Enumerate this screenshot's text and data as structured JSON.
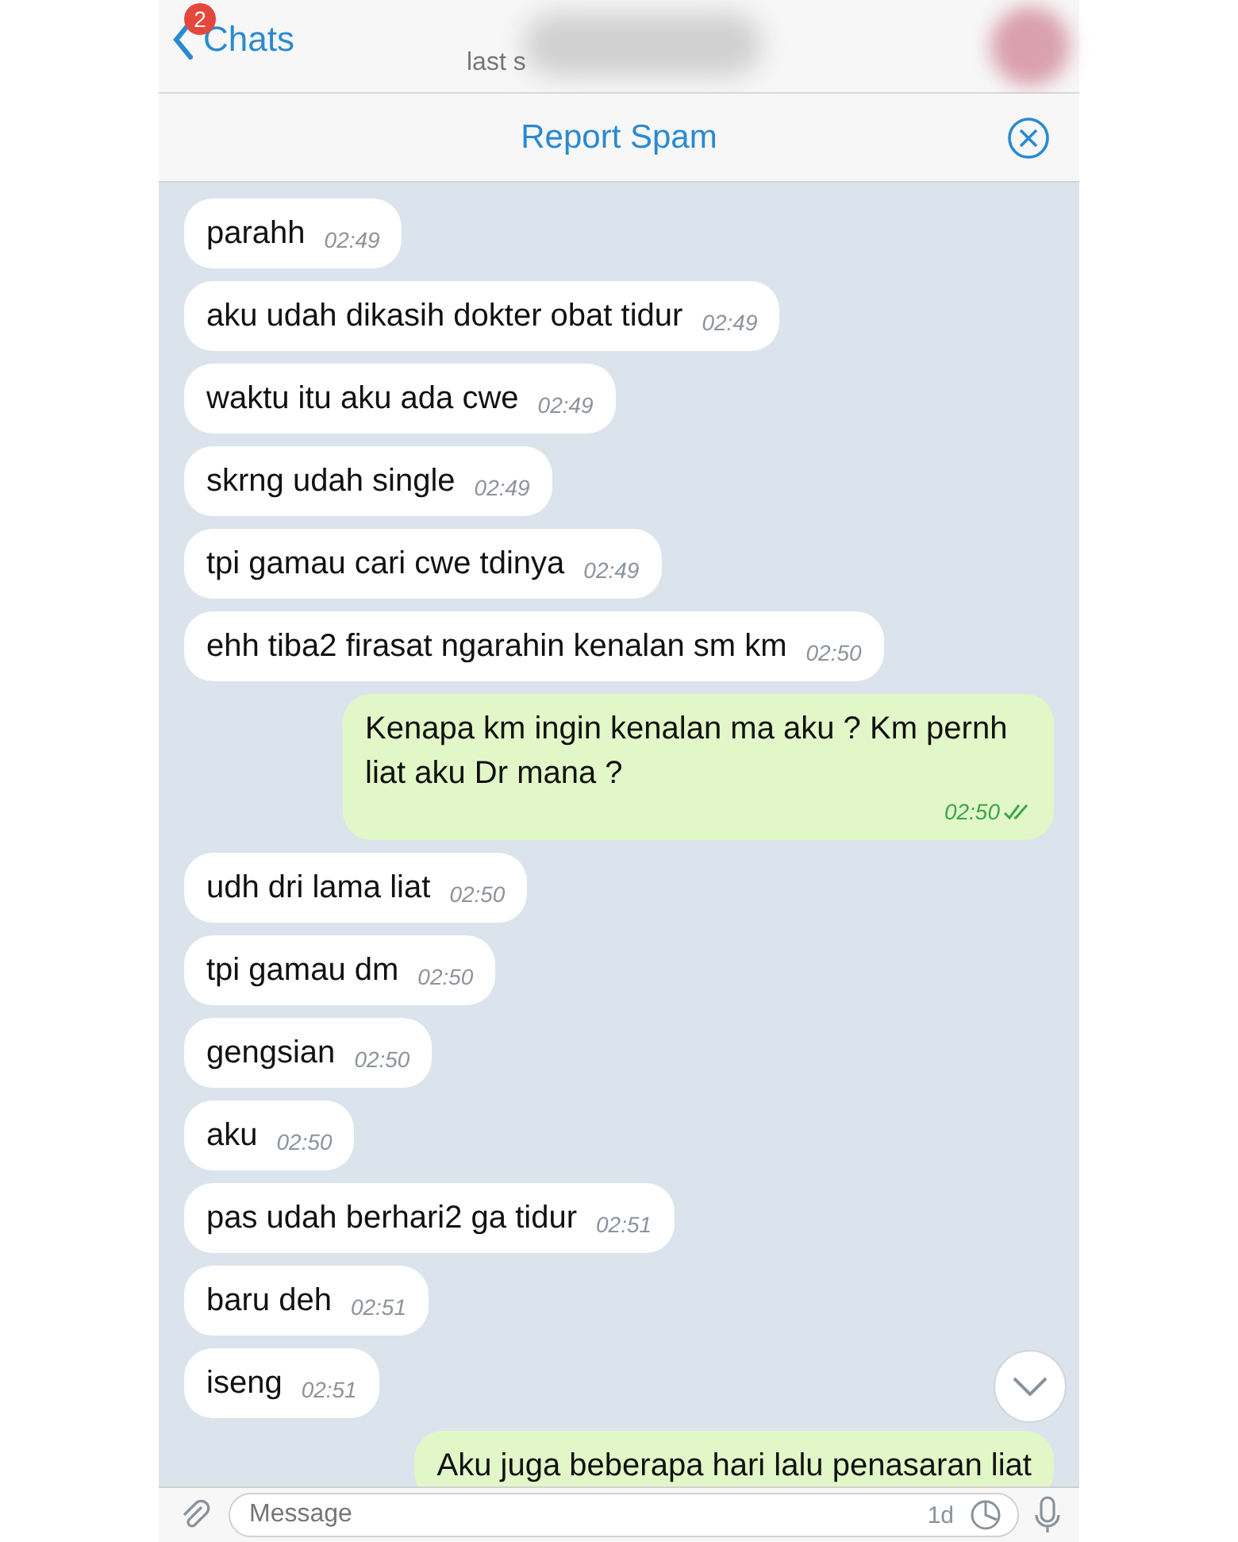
{
  "header": {
    "back_label": "Chats",
    "unread_badge": "2",
    "subtitle": "last s"
  },
  "report_bar": {
    "label": "Report Spam"
  },
  "messages": [
    {
      "kind": "incoming",
      "text": "parahh",
      "time": "02:49"
    },
    {
      "kind": "incoming",
      "text": "aku udah dikasih dokter obat tidur",
      "time": "02:49"
    },
    {
      "kind": "incoming",
      "text": "waktu itu aku ada cwe",
      "time": "02:49"
    },
    {
      "kind": "incoming",
      "text": "skrng udah single",
      "time": "02:49"
    },
    {
      "kind": "incoming",
      "text": "tpi gamau cari cwe tdinya",
      "time": "02:49"
    },
    {
      "kind": "incoming",
      "text": "ehh tiba2 firasat ngarahin kenalan sm km",
      "time": "02:50"
    },
    {
      "kind": "outgoing",
      "text": "Kenapa km ingin kenalan ma aku ? Km pernh liat aku Dr mana ?",
      "time": "02:50",
      "read": true
    },
    {
      "kind": "incoming",
      "text": "udh dri lama liat",
      "time": "02:50"
    },
    {
      "kind": "incoming",
      "text": "tpi gamau dm",
      "time": "02:50"
    },
    {
      "kind": "incoming",
      "text": "gengsian",
      "time": "02:50"
    },
    {
      "kind": "incoming",
      "text": "aku",
      "time": "02:50"
    },
    {
      "kind": "incoming",
      "text": "pas udah berhari2 ga tidur",
      "time": "02:51"
    },
    {
      "kind": "incoming",
      "text": "baru deh",
      "time": "02:51"
    },
    {
      "kind": "incoming",
      "text": "iseng",
      "time": "02:51"
    },
    {
      "kind": "outgoing",
      "text": "Aku juga beberapa hari lalu penasaran liat"
    }
  ],
  "composer": {
    "placeholder": "Message",
    "timer": "1d"
  }
}
